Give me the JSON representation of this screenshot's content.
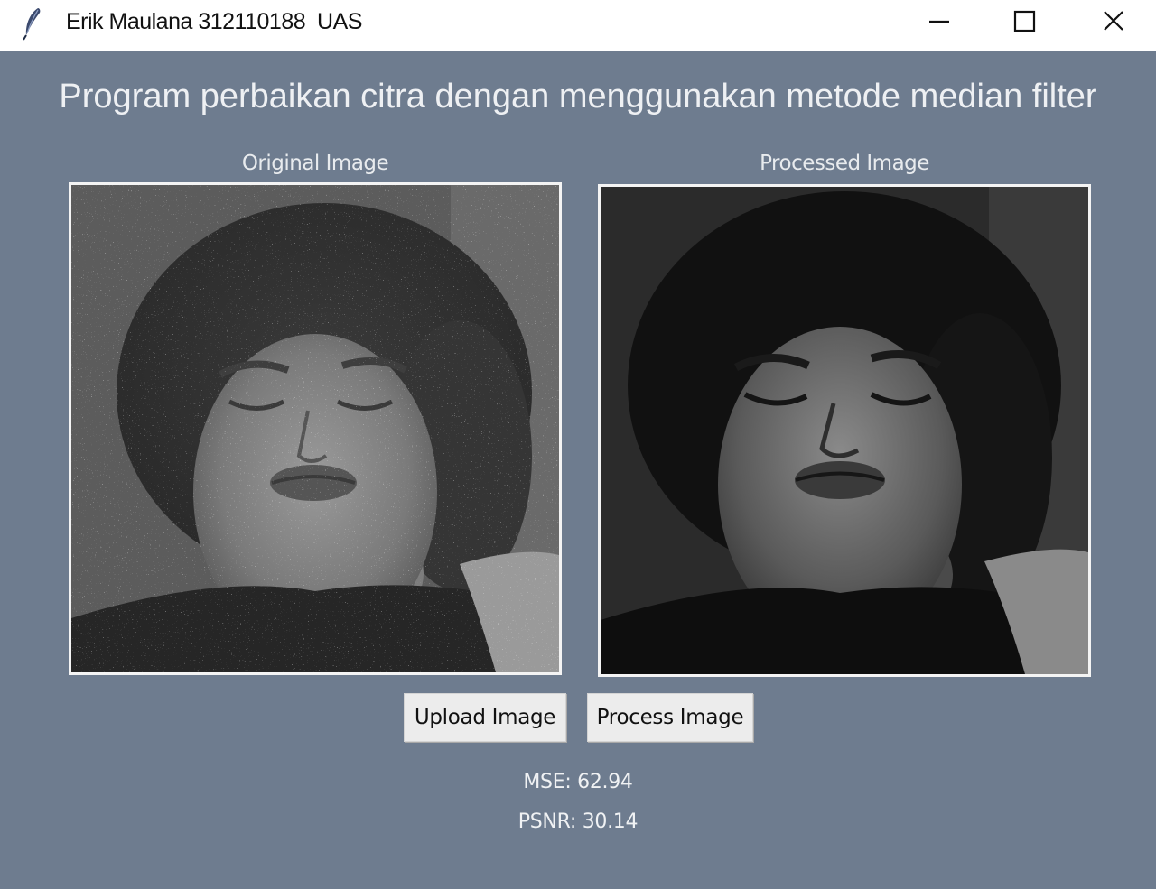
{
  "window": {
    "title": "Erik Maulana 312110188  UAS",
    "icon": "feather-icon",
    "controls": [
      "minimize-icon",
      "maximize-icon",
      "close-icon"
    ]
  },
  "heading": "Program perbaikan citra dengan menggunakan metode median filter",
  "images": {
    "original_label": "Original Image",
    "processed_label": "Processed Image"
  },
  "buttons": {
    "upload_label": "Upload Image",
    "process_label": "Process Image"
  },
  "metrics": {
    "mse_text": "MSE: 62.94",
    "psnr_text": "PSNR: 30.14"
  },
  "colors": {
    "background": "#6e7c8f",
    "titlebar": "#ffffff",
    "button": "#ececec"
  }
}
